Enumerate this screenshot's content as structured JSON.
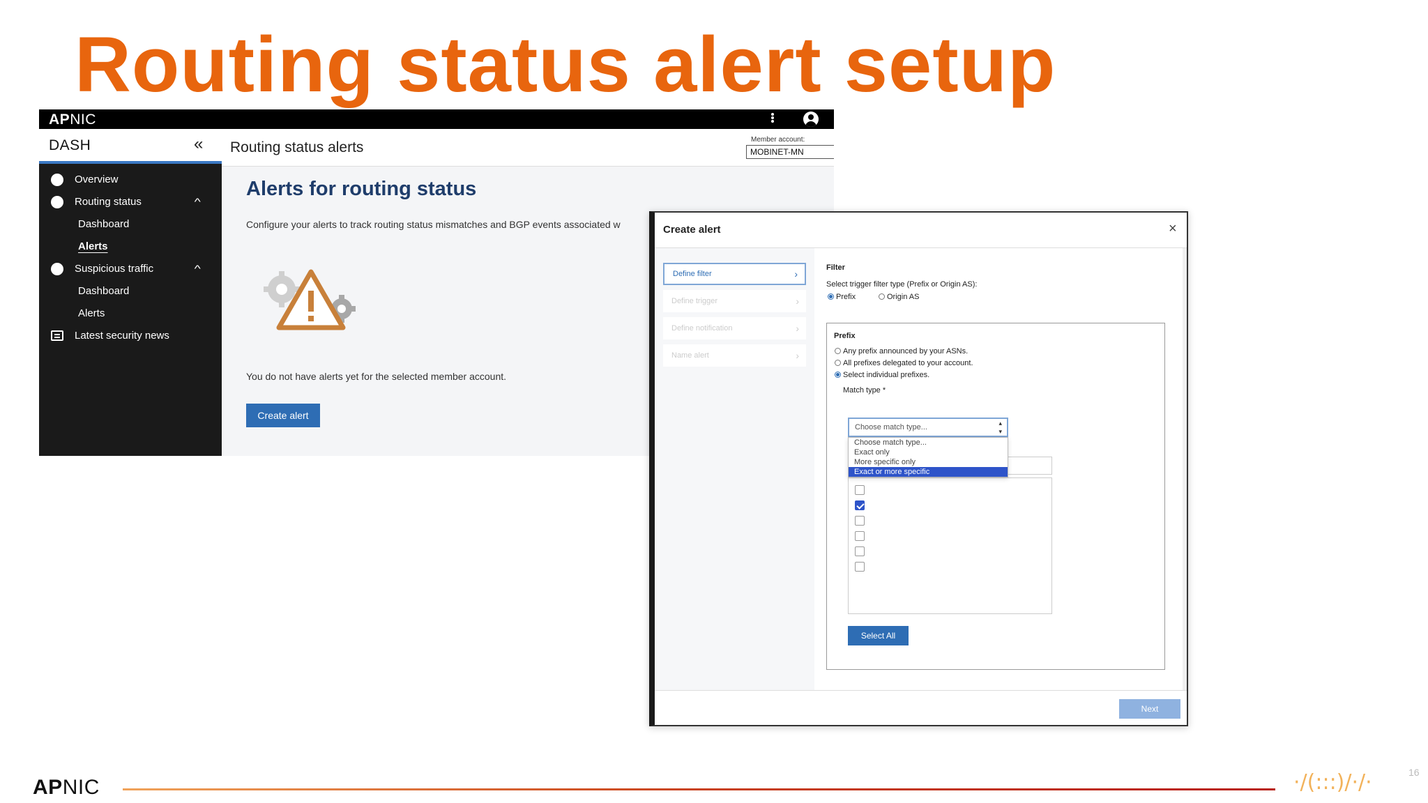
{
  "slide": {
    "title": "Routing status alert setup",
    "page_number": "16"
  },
  "app": {
    "logo_bold": "AP",
    "logo_thin": "NIC",
    "sidebar": {
      "title": "DASH",
      "collapse_glyph": "«",
      "items": [
        {
          "label": "Overview",
          "icon": "overview-icon"
        },
        {
          "label": "Routing status",
          "icon": "routing-status-icon",
          "expanded": true
        },
        {
          "label": "Dashboard"
        },
        {
          "label": "Alerts",
          "active": true
        },
        {
          "label": "Suspicious traffic",
          "icon": "suspicious-traffic-icon",
          "expanded": true
        },
        {
          "label": "Dashboard"
        },
        {
          "label": "Alerts"
        },
        {
          "label": "Latest security news",
          "icon": "news-icon"
        }
      ]
    },
    "header": {
      "title": "Routing status alerts",
      "member_label": "Member account:",
      "member_value": "MOBINET-MN"
    },
    "main": {
      "title": "Alerts for routing status",
      "description": "Configure your alerts to track routing status mismatches and BGP events associated w",
      "empty_message": "You do not have alerts yet for the selected member account.",
      "create_button": "Create alert"
    }
  },
  "modal": {
    "title": "Create alert",
    "close_glyph": "×",
    "steps": [
      "Define filter",
      "Define trigger",
      "Define notification",
      "Name alert"
    ],
    "filter": {
      "heading": "Filter",
      "prompt": "Select trigger filter type (Prefix or Origin AS):",
      "types": [
        {
          "label": "Prefix",
          "selected": true
        },
        {
          "label": "Origin AS",
          "selected": false
        }
      ],
      "prefix_heading": "Prefix",
      "prefix_options": [
        {
          "label": "Any prefix announced by your ASNs.",
          "selected": false
        },
        {
          "label": "All prefixes delegated to your account.",
          "selected": false
        },
        {
          "label": "Select individual prefixes.",
          "selected": true
        }
      ],
      "match_type_label": "Match type *",
      "match_type_value": "Choose match type...",
      "match_type_options": [
        "Choose match type...",
        "Exact only",
        "More specific only",
        "Exact or more specific"
      ],
      "highlighted_option": "Exact or more specific",
      "checkboxes": [
        false,
        true,
        false,
        false,
        false,
        false
      ],
      "select_all": "Select All"
    },
    "next_button": "Next"
  },
  "colors": {
    "title_orange": "#e8650e",
    "primary_blue": "#2e6db4",
    "heading_navy": "#1f3d6b"
  }
}
